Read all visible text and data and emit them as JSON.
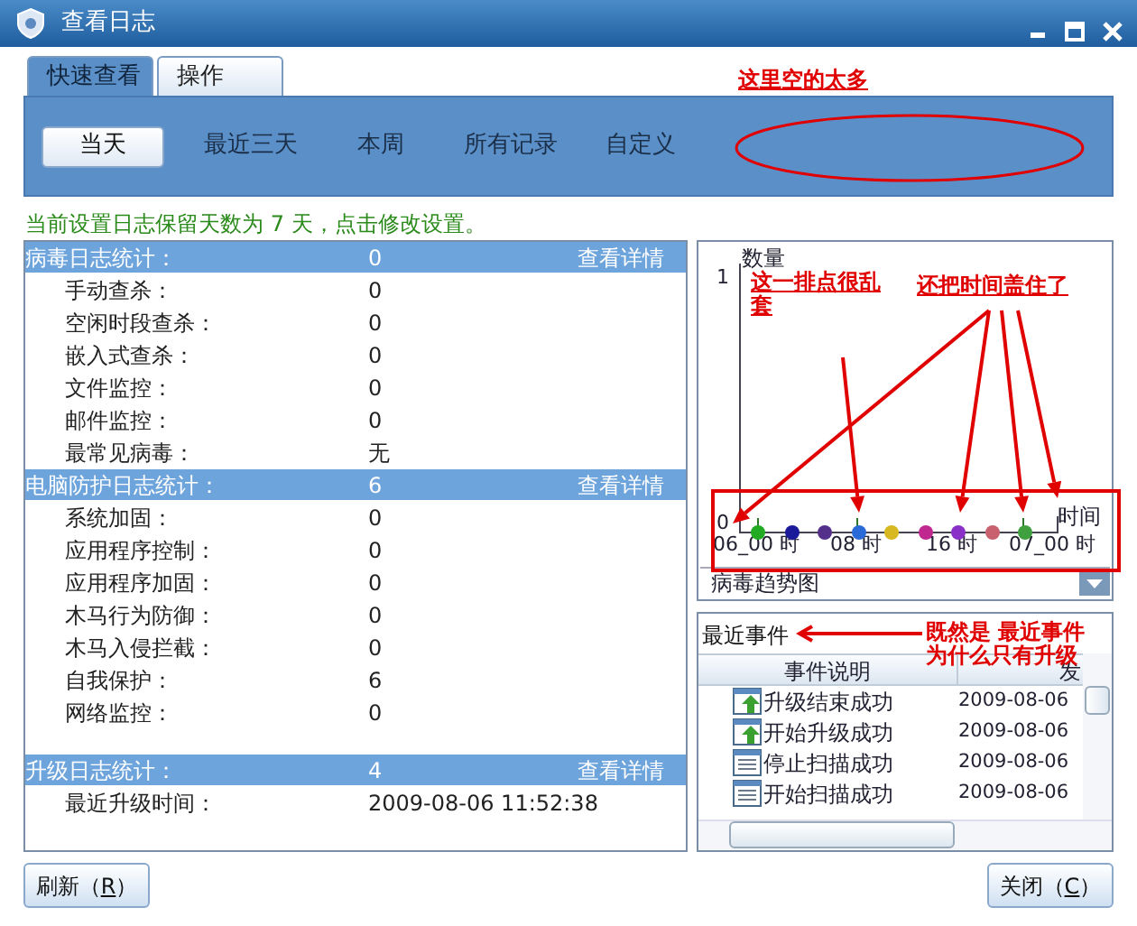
{
  "window": {
    "title": "查看日志"
  },
  "tabs": [
    {
      "label": "快速查看",
      "selected": true
    },
    {
      "label": "操作",
      "selected": false
    }
  ],
  "ranges": [
    {
      "label": "当天",
      "selected": true
    },
    {
      "label": "最近三天",
      "selected": false
    },
    {
      "label": "本周",
      "selected": false
    },
    {
      "label": "所有记录",
      "selected": false
    },
    {
      "label": "自定义",
      "selected": false
    }
  ],
  "retention_notice": "当前设置日志保留天数为 7 天，点击修改设置。",
  "stats": [
    {
      "title": "病毒日志统计：",
      "count": "0",
      "link": "查看详情",
      "items": [
        {
          "label": "手动查杀：",
          "value": "0"
        },
        {
          "label": "空闲时段查杀：",
          "value": "0"
        },
        {
          "label": "嵌入式查杀：",
          "value": "0"
        },
        {
          "label": "文件监控：",
          "value": "0"
        },
        {
          "label": "邮件监控：",
          "value": "0"
        },
        {
          "label": "最常见病毒：",
          "value": "无"
        }
      ]
    },
    {
      "title": "电脑防护日志统计：",
      "count": "6",
      "link": "查看详情",
      "items": [
        {
          "label": "系统加固：",
          "value": "0"
        },
        {
          "label": "应用程序控制：",
          "value": "0"
        },
        {
          "label": "应用程序加固：",
          "value": "0"
        },
        {
          "label": "木马行为防御：",
          "value": "0"
        },
        {
          "label": "木马入侵拦截：",
          "value": "0"
        },
        {
          "label": "自我保护：",
          "value": "6"
        },
        {
          "label": "网络监控：",
          "value": "0"
        }
      ]
    },
    {
      "title": "升级日志统计：",
      "count": "4",
      "link": "查看详情",
      "items": [
        {
          "label": "最近升级时间：",
          "value": "2009-08-06 11:52:38"
        }
      ]
    }
  ],
  "trend_chart": {
    "y_label": "数量",
    "y_ticks": [
      "1",
      "0"
    ],
    "x_label": "时间",
    "x_ticks": [
      "06_00 时",
      "08 时",
      "16 时",
      "07_00 时"
    ],
    "points": [
      {
        "color": "#22aa22"
      },
      {
        "color": "#1a1a9a"
      },
      {
        "color": "#55308a"
      },
      {
        "color": "#2a6ad8"
      },
      {
        "color": "#d8b820"
      },
      {
        "color": "#c02890"
      },
      {
        "color": "#8a30c8"
      },
      {
        "color": "#c86070"
      },
      {
        "color": "#40a040"
      }
    ],
    "selector": "病毒趋势图"
  },
  "recent_events": {
    "title": "最近事件",
    "columns": [
      "事件说明",
      "发"
    ],
    "rows": [
      {
        "kind": "upgrade",
        "event": "升级结束成功",
        "date": "2009-08-06"
      },
      {
        "kind": "upgrade",
        "event": "开始升级成功",
        "date": "2009-08-06"
      },
      {
        "kind": "scan",
        "event": "停止扫描成功",
        "date": "2009-08-06"
      },
      {
        "kind": "scan",
        "event": "开始扫描成功",
        "date": "2009-08-06"
      }
    ]
  },
  "buttons": [
    {
      "label": "刷新（",
      "key": "R",
      "end": "）"
    },
    {
      "label": "关闭（",
      "key": "C",
      "end": "）"
    }
  ],
  "annotations": [
    {
      "text": "这里空的太多"
    },
    {
      "text": "这一排点很乱套"
    },
    {
      "text": "还把时间盖住了"
    },
    {
      "text": "既然是  最近事件"
    },
    {
      "text": "为什么只有升级"
    }
  ]
}
